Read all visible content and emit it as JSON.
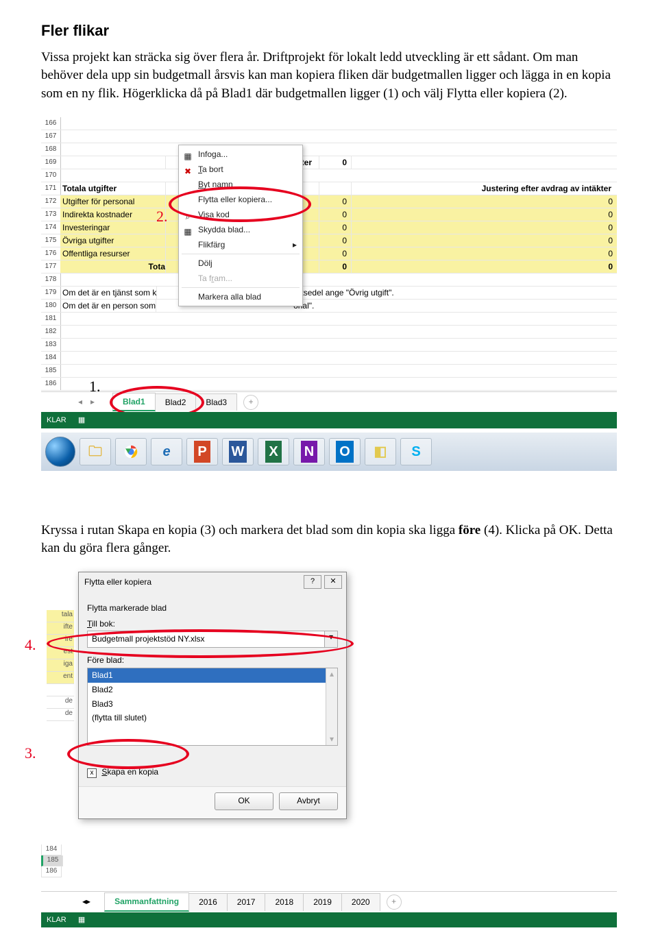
{
  "doc": {
    "heading": "Fler flikar",
    "para1": "Vissa projekt kan sträcka sig över flera år. Driftprojekt för lokalt ledd utveckling är ett sådant. Om man behöver dela upp sin budgetmall årsvis kan man kopiera fliken där budgetmallen ligger och lägga in en kopia som en ny flik. Högerklicka då på Blad1 där budgetmallen ligger (1) och välj Flytta eller kopiera (2).",
    "para2a": "Kryssa i rutan Skapa en kopia (3) och markera det blad som din kopia ska ligga ",
    "para2b_bold": "före",
    "para2c": " (4). Klicka på OK. Detta kan du göra flera gånger."
  },
  "shot1": {
    "rownums": [
      "166",
      "167",
      "168",
      "169",
      "170",
      "171",
      "172",
      "173",
      "174",
      "175",
      "176",
      "177",
      "178",
      "179",
      "180",
      "181",
      "182",
      "183",
      "184",
      "185",
      "186"
    ],
    "totalt_intakter": "Totalt intäkter",
    "zero": "0",
    "totala_utgifter": "Totala utgifter",
    "justering": "Justering efter avdrag av intäkter",
    "r172": "Utgifter för personal",
    "r173": "Indirekta kostnader",
    "r174": "Investeringar",
    "r175": "Övriga utgifter",
    "r176": "Offentliga resurser",
    "r177": "Tota",
    "r179": "Om det är en tjänst som k",
    "r180": "Om det är en person som",
    "note_tail": "attsedel ange \"Övrig utgift\".",
    "note_tail2": "onal\".",
    "marker1": "1.",
    "marker2": "2.",
    "ctx": {
      "infoga": "Infoga...",
      "tabort": "Ta bort",
      "bytnamn": "Byt namn",
      "flytta": "Flytta eller kopiera...",
      "visakod": "Visa kod",
      "skydda": "Skydda blad...",
      "flikfarg": "Flikfärg",
      "dolj": "Dölj",
      "tafram": "Ta fram...",
      "markera": "Markera alla blad"
    },
    "tabs": {
      "b1": "Blad1",
      "b2": "Blad2",
      "b3": "Blad3"
    },
    "status": "KLAR"
  },
  "shot2": {
    "marker3": "3.",
    "marker4": "4.",
    "peek": [
      "tala",
      "ifte",
      "ire",
      "est",
      "iga",
      "ent",
      "",
      "de",
      "de"
    ],
    "dlg": {
      "title": "Flytta eller kopiera",
      "moveselected": "Flytta markerade blad",
      "tillbok": "Till bok:",
      "bookname": "Budgetmall projektstöd NY.xlsx",
      "foreblad": "Före blad:",
      "opts": [
        "Blad1",
        "Blad2",
        "Blad3",
        "(flytta till slutet)"
      ],
      "skapa": "Skapa en kopia",
      "chk": "x",
      "ok": "OK",
      "avbryt": "Avbryt"
    },
    "botrows": [
      "184",
      "185",
      "186"
    ],
    "tabs2": [
      "Sammanfattning",
      "2016",
      "2017",
      "2018",
      "2019",
      "2020"
    ],
    "status": "KLAR"
  }
}
